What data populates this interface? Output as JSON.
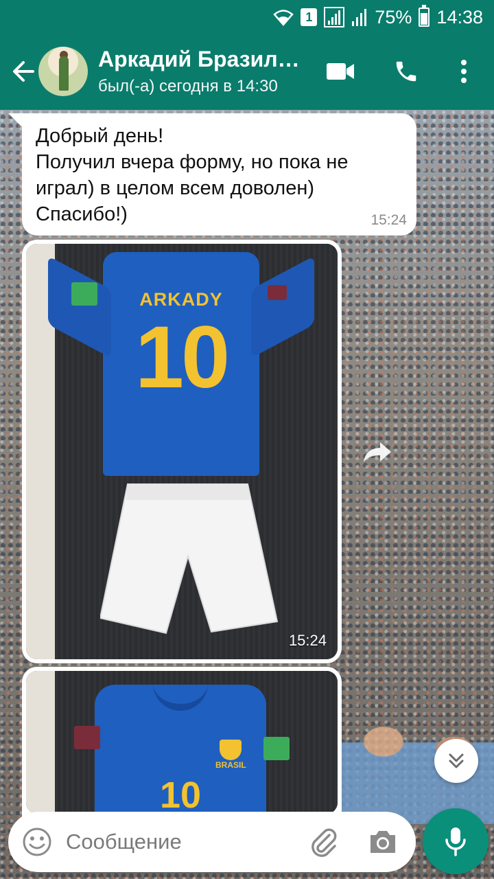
{
  "status_bar": {
    "sim_slot": "1",
    "battery": "75%",
    "battery_level": 0.75,
    "time": "14:38"
  },
  "header": {
    "contact_name": "Аркадий Бразил…",
    "last_seen": "был(-а) сегодня в 14:30"
  },
  "messages": [
    {
      "type": "text",
      "lines": [
        "Добрый день!",
        "Получил вчера форму, но пока не",
        "играл) в целом всем доволен)",
        "Спасибо!)"
      ],
      "time": "15:24"
    },
    {
      "type": "image",
      "jersey_name": "ARKADY",
      "jersey_number": "10",
      "time": "15:24"
    },
    {
      "type": "image",
      "crest_text": "BRASIL",
      "jersey_number": "10"
    }
  ],
  "composer": {
    "placeholder": "Сообщение"
  },
  "colors": {
    "header": "#0a7c6c",
    "fab": "#0a8f7b",
    "jersey_blue": "#1f5fbf",
    "jersey_yellow": "#f2c230"
  },
  "icons": [
    "back-arrow-icon",
    "video-call-icon",
    "phone-icon",
    "more-vert-icon",
    "wifi-icon",
    "signal-icon",
    "battery-icon",
    "forward-icon",
    "double-chevron-down-icon",
    "emoji-icon",
    "paperclip-icon",
    "camera-icon",
    "microphone-icon"
  ]
}
